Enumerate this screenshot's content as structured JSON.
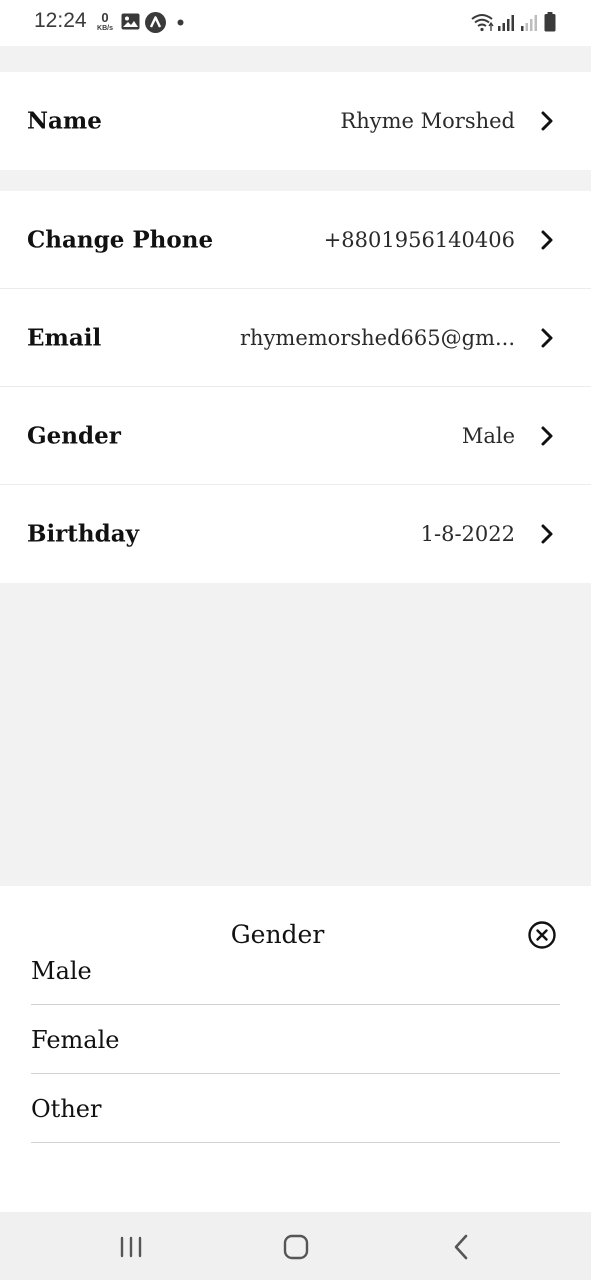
{
  "status_bar": {
    "time": "12:24",
    "net_speed_value": "0",
    "net_speed_unit": "KB/s",
    "icons": [
      "image-icon",
      "app-a-icon",
      "dot-icon",
      "wifi-icon",
      "signal-icon",
      "signal-icon",
      "battery-icon"
    ]
  },
  "profile": {
    "name": {
      "label": "Name",
      "value": "Rhyme Morshed"
    },
    "phone": {
      "label": "Change Phone",
      "value": "+8801956140406"
    },
    "email": {
      "label": "Email",
      "value": "rhymemorshed665@gm..."
    },
    "gender": {
      "label": "Gender",
      "value": "Male"
    },
    "birthday": {
      "label": "Birthday",
      "value": "1-8-2022"
    }
  },
  "gender_sheet": {
    "title": "Gender",
    "options": [
      "Male",
      "Female",
      "Other"
    ]
  },
  "nav_bar": {
    "icons": [
      "recent-apps-icon",
      "home-icon",
      "back-icon"
    ]
  },
  "colors": {
    "background": "#f2f2f2",
    "surface": "#ffffff",
    "text": "#111111",
    "divider": "#d2d2d2"
  }
}
